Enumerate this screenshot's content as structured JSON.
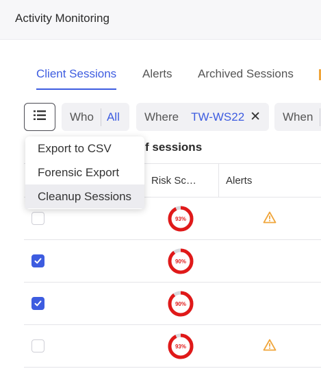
{
  "header": {
    "title": "Activity Monitoring"
  },
  "tabs": [
    {
      "label": "Client Sessions",
      "active": true
    },
    {
      "label": "Alerts",
      "active": false
    },
    {
      "label": "Archived Sessions",
      "active": false
    }
  ],
  "filters": {
    "who": {
      "key": "Who",
      "value": "All"
    },
    "where": {
      "key": "Where",
      "value": "TW-WS22",
      "remove": "✕"
    },
    "when": {
      "key": "When"
    }
  },
  "menu": {
    "items": [
      "Export to CSV",
      "Forensic Export",
      "Cleanup Sessions"
    ],
    "highlighted": "Cleanup Sessions"
  },
  "subtitle": "f sessions",
  "table": {
    "columns": [
      "Risk Sc…",
      "Alerts"
    ],
    "rows": [
      {
        "checked": false,
        "risk": "93%",
        "risk_value": 0.93,
        "alert": true
      },
      {
        "checked": true,
        "risk": "90%",
        "risk_value": 0.9,
        "alert": false
      },
      {
        "checked": true,
        "risk": "90%",
        "risk_value": 0.9,
        "alert": false
      },
      {
        "checked": false,
        "risk": "93%",
        "risk_value": 0.93,
        "alert": true
      }
    ]
  },
  "colors": {
    "accent": "#3d5ce0",
    "risk": "#e01919",
    "warning": "#f0a53a"
  },
  "icons": {
    "menu_button": "list-icon",
    "alert": "warning-icon",
    "checkbox": "checkmark-icon"
  }
}
